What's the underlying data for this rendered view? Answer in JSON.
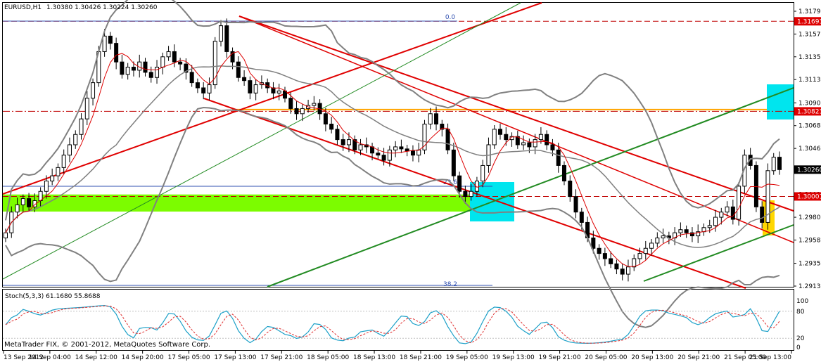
{
  "header": {
    "symbol": "EURUSD,H1",
    "quotes": "1.30380 1.30426 1.30224 1.30260"
  },
  "indicator": {
    "label": "Stoch(5,3,3) 61.1680 55.8688"
  },
  "footer": {
    "copyright": "MetaTrader FIX, © 2001-2012, MetaQuotes Software Corp."
  },
  "fib_labels": [
    "0.0",
    "23.6",
    "38.2"
  ],
  "colors": {
    "up_candle": "#ffffff",
    "down_candle": "#000000",
    "bollinger": "#808080",
    "ma": "#dd0000",
    "channel_red": "#e00000",
    "channel_green": "#228b22",
    "orange_level": "#ffa500",
    "green_zone": "#7cfc00",
    "cyan_zone": "#00e5ee",
    "yellow_zone": "#ffd700",
    "stoch_main": "#1ca0c8",
    "stoch_signal": "#e03030"
  },
  "chart_data": {
    "type": "candlestick",
    "price_axis_ticks": [
      "1.31790",
      "1.31570",
      "1.31350",
      "1.31130",
      "1.30905",
      "1.30685",
      "1.30465",
      "1.30245",
      "1.30020",
      "1.29800",
      "1.29580",
      "1.29355",
      "1.29135"
    ],
    "highlighted_levels": [
      {
        "value": "1.31693",
        "style": "dashed-red"
      },
      {
        "value": "1.30823",
        "style": "dashdot-red"
      },
      {
        "value": "1.30260",
        "style": "current-price"
      },
      {
        "value": "1.30001",
        "style": "dashed-red"
      }
    ],
    "time_axis_ticks": [
      "13 Sep 2012",
      "14 Sep 04:00",
      "14 Sep 12:00",
      "14 Sep 20:00",
      "17 Sep 05:00",
      "17 Sep 13:00",
      "17 Sep 21:00",
      "18 Sep 05:00",
      "18 Sep 13:00",
      "18 Sep 21:00",
      "19 Sep 05:00",
      "19 Sep 13:00",
      "19 Sep 21:00",
      "20 Sep 05:00",
      "20 Sep 13:00",
      "20 Sep 21:00",
      "21 Sep 05:00",
      "21 Sep 13:00"
    ],
    "stoch_axis_ticks": [
      "100",
      "80",
      "20",
      "0"
    ],
    "close_path": [
      1.2965,
      1.2985,
      1.2992,
      1.2998,
      1.299,
      1.2996,
      1.3005,
      1.3015,
      1.302,
      1.3028,
      1.304,
      1.305,
      1.306,
      1.3075,
      1.3095,
      1.311,
      1.314,
      1.3155,
      1.3148,
      1.313,
      1.3118,
      1.3125,
      1.3122,
      1.313,
      1.312,
      1.3115,
      1.3125,
      1.3135,
      1.314,
      1.313,
      1.3128,
      1.312,
      1.311,
      1.3105,
      1.31,
      1.3108,
      1.315,
      1.3165,
      1.314,
      1.313,
      1.3115,
      1.3112,
      1.31,
      1.3108,
      1.311,
      1.3105,
      1.31,
      1.3102,
      1.3095,
      1.3085,
      1.308,
      1.3085,
      1.3088,
      1.309,
      1.308,
      1.307,
      1.3065,
      1.3055,
      1.305,
      1.3055,
      1.3045,
      1.305,
      1.3048,
      1.3042,
      1.304,
      1.3035,
      1.3045,
      1.3048,
      1.3046,
      1.3044,
      1.304,
      1.3045,
      1.307,
      1.308,
      1.307,
      1.3065,
      1.3045,
      1.302,
      1.3005,
      1.3,
      1.3005,
      1.3015,
      1.303,
      1.305,
      1.3065,
      1.306,
      1.3055,
      1.3058,
      1.305,
      1.3052,
      1.3048,
      1.3055,
      1.306,
      1.305,
      1.3045,
      1.303,
      1.3015,
      1.3,
      1.2985,
      1.2975,
      1.296,
      1.295,
      1.2945,
      1.294,
      1.2935,
      1.293,
      1.2925,
      1.2932,
      1.294,
      1.2945,
      1.295,
      1.2955,
      1.296,
      1.2962,
      1.296,
      1.2965,
      1.2968,
      1.2965,
      1.2962,
      1.2966,
      1.297,
      1.2972,
      1.298,
      1.2985,
      1.299,
      1.2978,
      1.301,
      1.304,
      1.303,
      1.299,
      1.2975,
      1.3025,
      1.3038,
      1.3026
    ]
  }
}
